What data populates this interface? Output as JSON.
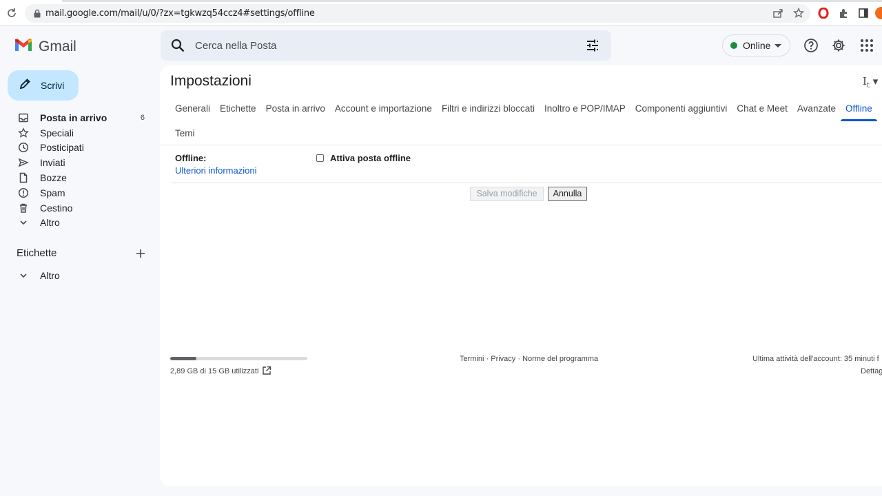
{
  "browser": {
    "url": "mail.google.com/mail/u/0/?zx=tgkwzq54ccz4#settings/offline"
  },
  "header": {
    "app_name": "Gmail",
    "search_placeholder": "Cerca nella Posta",
    "status_label": "Online",
    "status_color": "#1e8e3e"
  },
  "sidebar": {
    "compose_label": "Scrivi",
    "items": [
      {
        "label": "Posta in arrivo",
        "count": "6",
        "icon": "inbox-icon"
      },
      {
        "label": "Speciali",
        "icon": "star-icon"
      },
      {
        "label": "Posticipati",
        "icon": "clock-icon"
      },
      {
        "label": "Inviati",
        "icon": "send-icon"
      },
      {
        "label": "Bozze",
        "icon": "draft-icon"
      },
      {
        "label": "Spam",
        "icon": "spam-icon"
      },
      {
        "label": "Cestino",
        "icon": "trash-icon"
      },
      {
        "label": "Altro",
        "icon": "chevron-down-icon"
      }
    ],
    "labels_title": "Etichette",
    "labels_more": "Altro"
  },
  "settings": {
    "title": "Impostazioni",
    "tabs": [
      "Generali",
      "Etichette",
      "Posta in arrivo",
      "Account e importazione",
      "Filtri e indirizzi bloccati",
      "Inoltro e POP/IMAP",
      "Componenti aggiuntivi",
      "Chat e Meet",
      "Avanzate",
      "Offline",
      "Temi"
    ],
    "active_tab": "Offline",
    "offline_title": "Offline:",
    "learn_more": "Ulteriori informazioni",
    "checkbox_label": "Attiva posta offline",
    "save_label": "Salva modifiche",
    "cancel_label": "Annulla"
  },
  "footer": {
    "storage_text": "2,89 GB di 15 GB utilizzati",
    "storage_fraction": 0.19,
    "links": [
      "Termini",
      "Privacy",
      "Norme del programma"
    ],
    "last_activity": "Ultima attività dell'account: 35 minuti f",
    "details": "Dettag"
  },
  "colors": {
    "accent": "#0b57d0",
    "compose_bg": "#c2e7ff",
    "app_bg": "#f6f8fc"
  }
}
